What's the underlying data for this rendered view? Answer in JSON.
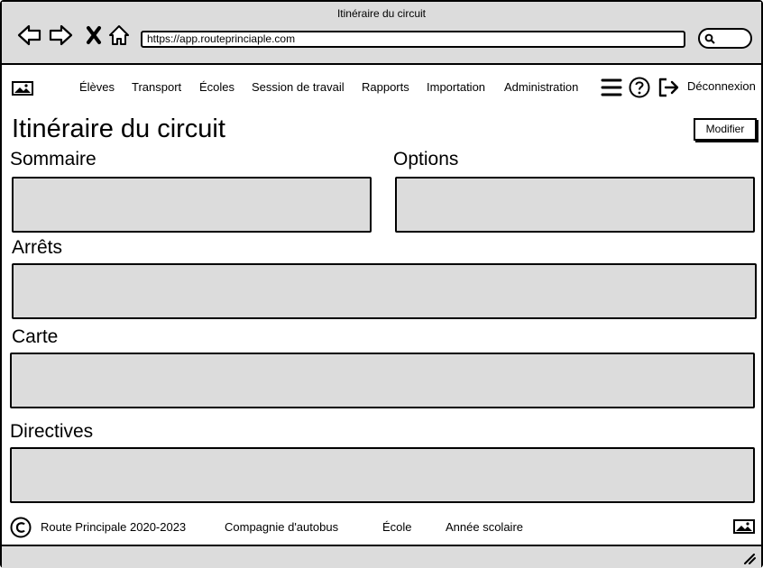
{
  "window": {
    "title": "Itinéraire du circuit"
  },
  "browser": {
    "url": "https://app.routeprinciaple.com"
  },
  "nav": {
    "links": [
      "Élèves",
      "Transport",
      "Écoles",
      "Session de travail",
      "Rapports",
      "Importation",
      "Administration"
    ],
    "logout_label": "Déconnexion"
  },
  "page": {
    "title": "Itinéraire du circuit",
    "edit_button": "Modifier"
  },
  "sections": {
    "summary": "Sommaire",
    "options": "Options",
    "stops": "Arrêts",
    "map": "Carte",
    "directions": "Directives"
  },
  "footer": {
    "copyright": "Route Principale 2020-2023",
    "company": "Compagnie d'autobus",
    "school": "École",
    "school_year": "Année scolaire"
  },
  "colors": {
    "panel": "#dcdcdc",
    "chrome": "#dcdcdc"
  }
}
